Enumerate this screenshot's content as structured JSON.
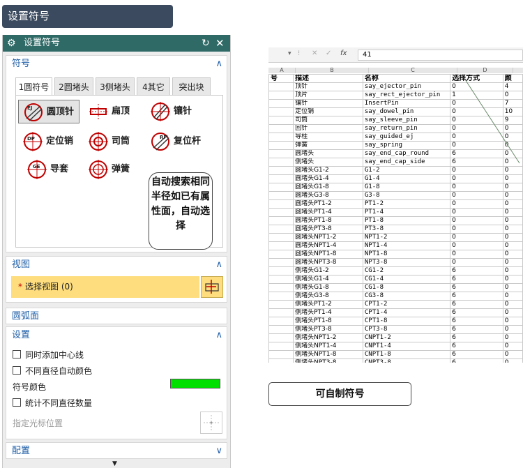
{
  "page_title": "设置符号",
  "dialog": {
    "title": "设置符号",
    "symbols_group": {
      "label": "符号",
      "tabs": [
        "1圆符号",
        "2圆堵头",
        "3侧堵头",
        "4其它",
        "突出块"
      ],
      "items": [
        {
          "label": "圆顶针",
          "icon": "ej-icon",
          "glyph": "EJ"
        },
        {
          "label": "扁顶",
          "icon": "flat-ejector-icon",
          "glyph": ""
        },
        {
          "label": "镶针",
          "icon": "insert-pin-icon",
          "glyph": ""
        },
        {
          "label": "定位销",
          "icon": "dowel-pin-icon",
          "glyph": "DP"
        },
        {
          "label": "司筒",
          "icon": "sleeve-icon",
          "glyph": ""
        },
        {
          "label": "复位杆",
          "icon": "return-pin-icon",
          "glyph": "RP"
        },
        {
          "label": "导套",
          "icon": "guide-bush-icon",
          "glyph": "GE"
        },
        {
          "label": "弹簧",
          "icon": "spring-icon",
          "glyph": ""
        }
      ],
      "note": "自动搜索相同半径如已有属性面，自动选择"
    },
    "view_group": {
      "label": "视图",
      "select_label": "选择视图 (0)",
      "required_mark": "*"
    },
    "arc_group": {
      "label": "圆弧面"
    },
    "settings_group": {
      "label": "设置",
      "add_centerline": "同时添加中心线",
      "auto_color": "不同直径自动颜色",
      "symbol_color_label": "符号颜色",
      "symbol_color": "#00e000",
      "count_diameters": "统计不同直径数量",
      "cursor_position": "指定光标位置"
    },
    "config_group": {
      "label": "配置"
    }
  },
  "spreadsheet": {
    "formula_value": "41",
    "columns": [
      "A",
      "B",
      "C",
      "D"
    ],
    "header": [
      "号",
      "描述",
      "名称",
      "选择方式",
      "颜"
    ],
    "rows": [
      [
        "顶针",
        "say_ejector_pin",
        "0",
        "4"
      ],
      [
        "顶片",
        "say_rect_ejector_pin",
        "1",
        "0"
      ],
      [
        "镶针",
        "InsertPin",
        "0",
        "7"
      ],
      [
        "定位销",
        "say_dowel_pin",
        "0",
        "10"
      ],
      [
        "司筒",
        "say_sleeve_pin",
        "0",
        "9"
      ],
      [
        "回针",
        "say_return_pin",
        "0",
        "0"
      ],
      [
        "导柱",
        "say_guided_ej",
        "0",
        "0"
      ],
      [
        "弹簧",
        "say_spring",
        "0",
        "0"
      ],
      [
        "圆堵头",
        "say_end_cap_round",
        "6",
        "0"
      ],
      [
        "侧堵头",
        "say_end_cap_side",
        "6",
        "0"
      ],
      [
        "圆堵头G1-2",
        "G1-2",
        "0",
        "0"
      ],
      [
        "圆堵头G1-4",
        "G1-4",
        "0",
        "0"
      ],
      [
        "圆堵头G1-8",
        "G1-8",
        "0",
        "0"
      ],
      [
        "圆堵头G3-8",
        "G3-8",
        "0",
        "0"
      ],
      [
        "圆堵头PT1-2",
        "PT1-2",
        "0",
        "0"
      ],
      [
        "圆堵头PT1-4",
        "PT1-4",
        "0",
        "0"
      ],
      [
        "圆堵头PT1-8",
        "PT1-8",
        "0",
        "0"
      ],
      [
        "圆堵头PT3-8",
        "PT3-8",
        "0",
        "0"
      ],
      [
        "圆堵头NPT1-2",
        "NPT1-2",
        "0",
        "0"
      ],
      [
        "圆堵头NPT1-4",
        "NPT1-4",
        "0",
        "0"
      ],
      [
        "圆堵头NPT1-8",
        "NPT1-8",
        "0",
        "0"
      ],
      [
        "圆堵头NPT3-8",
        "NPT3-8",
        "0",
        "0"
      ],
      [
        "侧堵头G1-2",
        "CG1-2",
        "6",
        "0"
      ],
      [
        "侧堵头G1-4",
        "CG1-4",
        "6",
        "0"
      ],
      [
        "侧堵头G1-8",
        "CG1-8",
        "6",
        "0"
      ],
      [
        "侧堵头G3-8",
        "CG3-8",
        "6",
        "0"
      ],
      [
        "侧堵头PT1-2",
        "CPT1-2",
        "6",
        "0"
      ],
      [
        "侧堵头PT1-4",
        "CPT1-4",
        "6",
        "0"
      ],
      [
        "侧堵头PT1-8",
        "CPT1-8",
        "6",
        "0"
      ],
      [
        "侧堵头PT3-8",
        "CPT3-8",
        "6",
        "0"
      ],
      [
        "侧堵头NPT1-2",
        "CNPT1-2",
        "6",
        "0"
      ],
      [
        "侧堵头NPT1-4",
        "CNPT1-4",
        "6",
        "0"
      ],
      [
        "侧堵头NPT1-8",
        "CNPT1-8",
        "6",
        "0"
      ],
      [
        "侧堵头NPT3-8",
        "CNPT3-8",
        "6",
        "0"
      ]
    ]
  },
  "caption": "可自制符号"
}
